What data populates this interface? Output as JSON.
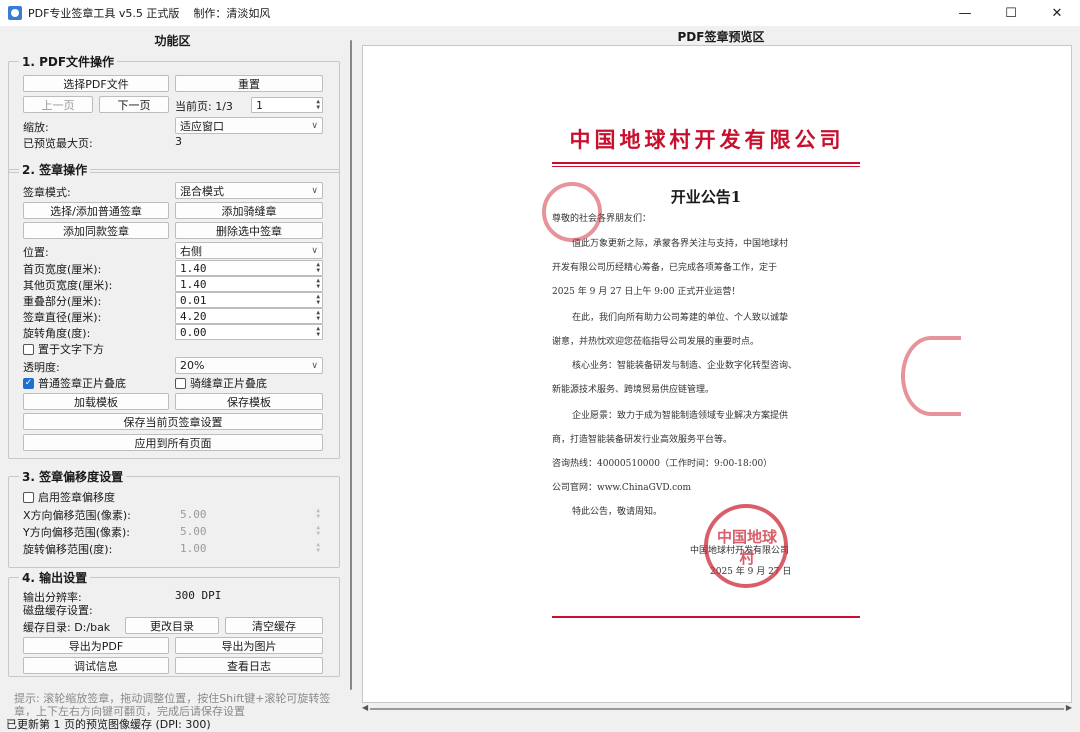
{
  "window": {
    "title": "PDF专业签章工具 v5.5 正式版",
    "author": "制作：清淡如风",
    "min_glyph": "—",
    "max_glyph": "☐",
    "close_glyph": "✕"
  },
  "left_panel": {
    "heading": "功能区",
    "pdf_ops": {
      "title": "1. PDF文件操作",
      "select_pdf": "选择PDF文件",
      "reset": "重置",
      "prev_page": "上一页",
      "next_page": "下一页",
      "current_page_label": "当前页: 1/3",
      "page_value": "1",
      "zoom_label": "缩放:",
      "zoom_value": "适应窗口",
      "max_preview_label": "已预览最大页:",
      "max_preview_value": "3"
    },
    "seal_ops": {
      "title": "2. 签章操作",
      "mode_label": "签章模式:",
      "mode_value": "混合模式",
      "select_add_seal": "选择/添加普通签章",
      "add_riding_seal": "添加骑缝章",
      "add_same_seal": "添加同款签章",
      "delete_selected": "删除选中签章",
      "position_label": "位置:",
      "position_value": "右侧",
      "first_width_label": "首页宽度(厘米):",
      "first_width_value": "1.40",
      "other_width_label": "其他页宽度(厘米):",
      "other_width_value": "1.40",
      "overlap_label": "重叠部分(厘米):",
      "overlap_value": "0.01",
      "diameter_label": "签章直径(厘米):",
      "diameter_value": "4.20",
      "rotation_label": "旋转角度(度):",
      "rotation_value": "0.00",
      "below_text": "置于文字下方",
      "opacity_label": "透明度:",
      "opacity_value": "20%",
      "normal_multiply": "普通签章正片叠底",
      "riding_multiply": "骑缝章正片叠底",
      "load_template": "加载模板",
      "save_template": "保存模板",
      "save_page_settings": "保存当前页签章设置",
      "apply_all_pages": "应用到所有页面"
    },
    "offset": {
      "title": "3. 签章偏移度设置",
      "enable": "启用签章偏移度",
      "x_label": "X方向偏移范围(像素):",
      "x_value": "5.00",
      "y_label": "Y方向偏移范围(像素):",
      "y_value": "5.00",
      "rot_label": "旋转偏移范围(度):",
      "rot_value": "1.00"
    },
    "output": {
      "title": "4. 输出设置",
      "dpi_label": "输出分辨率:",
      "dpi_value": "300 DPI",
      "cache_label": "磁盘缓存设置:",
      "cache_dir": "缓存目录: D:/bak",
      "change_dir": "更改目录",
      "clear_cache": "清空缓存",
      "export_pdf": "导出为PDF",
      "export_image": "导出为图片",
      "debug_info": "调试信息",
      "view_log": "查看日志"
    },
    "hint": "提示: 滚轮缩放签章，拖动调整位置，按住Shift键+滚轮可旋转签章，上下左右方向键可翻页，完成后请保存设置"
  },
  "status": "已更新第 1 页的预览图像缓存 (DPI: 300)",
  "preview": {
    "heading": "PDF签章预览区",
    "company": "中国地球村开发有限公司",
    "notice_title": "开业公告1",
    "greeting": "尊敬的社会各界朋友们：",
    "p1_l1": "值此万象更新之际，承蒙各界关注与支持，中国地球村",
    "p1_l2": "开发有限公司历经精心筹备，已完成各项筹备工作，定于",
    "p1_l3": "2025 年 9 月 27 日上午 9:00 正式开业运营！",
    "p2_l1": "在此，我们向所有助力公司筹建的单位、个人致以诚挚",
    "p2_l2": "谢意，并热忱欢迎您莅临指导公司发展的重要时点。",
    "p3_l1": "核心业务：智能装备研发与制造、企业数字化转型咨询、",
    "p3_l2": "新能源技术服务、跨境贸易供应链管理。",
    "p4_l1": "企业愿景：致力于成为智能制造领域专业解决方案提供",
    "p4_l2": "商，打造智能装备研发行业高效服务平台等。",
    "hotline": "咨询热线：40000510000（工作时间：9:00-18:00）",
    "website": "公司官网：www.ChinaGVD.com",
    "closing": "特此公告，敬请周知。",
    "sign_company": "中国地球村开发有限公司",
    "sign_date": "2025 年 9 月 27 日",
    "seal_text": "中国地球村"
  },
  "colors": {
    "accent": "#1f6fd0",
    "seal_red": "#c8102e"
  }
}
